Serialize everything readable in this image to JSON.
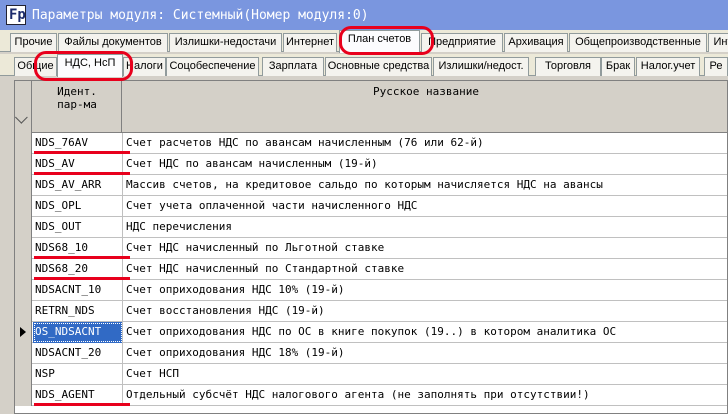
{
  "window": {
    "title": "Параметры модуля: Системный(Номер модуля:0)",
    "icon": "app-icon",
    "icon_glyph": "Fp"
  },
  "tabs_row1": [
    {
      "label": "Прочие"
    },
    {
      "label": "Файлы документов"
    },
    {
      "label": "Излишки-недостачи"
    },
    {
      "label": "Интернет"
    },
    {
      "label": "План счетов",
      "active": true
    },
    {
      "label": "Предприятие"
    },
    {
      "label": "Архивация"
    },
    {
      "label": "Общепроизводственные"
    },
    {
      "label": "Инт"
    }
  ],
  "tabs_row2": [
    {
      "label": "Общие"
    },
    {
      "label": "НДС, НсП",
      "active": true
    },
    {
      "label": "Налоги"
    },
    {
      "label": "Соцобеспечение"
    },
    {
      "label": "Зарплата"
    },
    {
      "label": "Основные средства"
    },
    {
      "label": "Излишки/недост."
    },
    {
      "label": "Торговля"
    },
    {
      "label": "Брак"
    },
    {
      "label": "Налог.учет"
    },
    {
      "label": "Ре"
    }
  ],
  "grid": {
    "columns": {
      "id": "Идент.\nпар-ма",
      "name": "Русское название"
    },
    "rows": [
      {
        "id": "NDS_76AV",
        "name": "Счет расчетов НДС по авансам начисленным (76 или 62-й)",
        "underlined": true
      },
      {
        "id": "NDS_AV",
        "name": "Счет НДС по авансам начисленным (19-й)",
        "underlined": true
      },
      {
        "id": "NDS_AV_ARR",
        "name": "Массив счетов, на кредитовое сальдо по которым начисляется НДС на авансы"
      },
      {
        "id": "NDS_OPL",
        "name": "Счет учета оплаченной части начисленного НДС"
      },
      {
        "id": "NDS_OUT",
        "name": "НДС перечисления"
      },
      {
        "id": "NDS68_10",
        "name": "Счет НДС начисленный по Льготной ставке",
        "underlined": true
      },
      {
        "id": "NDS68_20",
        "name": "Счет НДС начисленный по Стандартной ставке",
        "underlined": true
      },
      {
        "id": "NDSACNT_10",
        "name": "Счет оприходования НДС 10% (19-й)"
      },
      {
        "id": "RETRN_NDS",
        "name": "Счет восстановления НДС (19-й)"
      },
      {
        "id": "OS_NDSACNT",
        "name": "Счет оприходования НДС по ОС в книге покупок (19..) в котором аналитика ОС",
        "selected": true
      },
      {
        "id": "NDSACNT_20",
        "name": "Счет оприходования НДС 18% (19-й)"
      },
      {
        "id": "NSP",
        "name": "Счет НСП"
      },
      {
        "id": "NDS_AGENT",
        "name": "Отдельный субсчёт НДС налогового агента (не заполнять при отсутствии!)",
        "underlined": true
      }
    ]
  },
  "colors": {
    "highlight": "#e8001c",
    "selection": "#316ac5",
    "title_bar": "#7a96df"
  }
}
